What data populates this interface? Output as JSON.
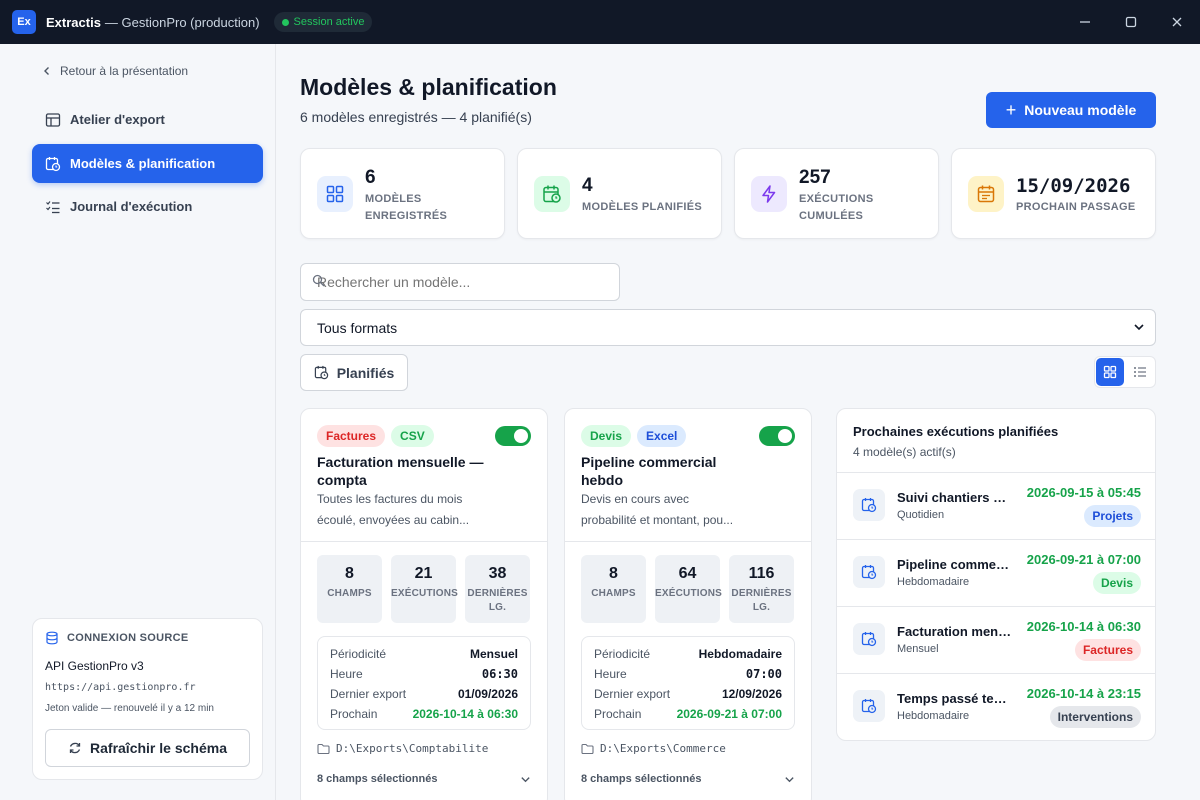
{
  "app": {
    "logo": "Ex",
    "name": "Extractis",
    "separator": "— GestionPro (production)",
    "session": "Session active",
    "window_controls": [
      "minimize-icon",
      "maximize-icon",
      "close-icon"
    ]
  },
  "sidebar": {
    "back_label": "Retour à la présentation",
    "items": [
      {
        "label": "Atelier d'export",
        "icon": "table-icon",
        "active": false
      },
      {
        "label": "Modèles & planification",
        "icon": "calendar-clock-icon",
        "active": true
      },
      {
        "label": "Journal d'exécution",
        "icon": "checklist-icon",
        "active": false
      }
    ],
    "source": {
      "title": "CONNEXION SOURCE",
      "api": "API GestionPro v3",
      "url": "https://api.gestionpro.fr",
      "token": "Jeton valide — renouvelé il y a 12 min",
      "refresh": "Rafraîchir le schéma"
    }
  },
  "header": {
    "title": "Modèles & planification",
    "subtitle": "6 modèles enregistrés — 4 planifié(s)",
    "new_button": "Nouveau modèle"
  },
  "stats": [
    {
      "value": "6",
      "label_lines": [
        "MODÈLES",
        "ENREGISTRÉS"
      ],
      "icon": "grid-icon",
      "color": "#2563eb",
      "bg": "#e8f0fe"
    },
    {
      "value": "4",
      "label_lines": [
        "MODÈLES PLANIFIÉS"
      ],
      "icon": "calendar-clock-icon",
      "color": "#16a34a",
      "bg": "#dcfce7"
    },
    {
      "value": "257",
      "label_lines": [
        "EXÉCUTIONS",
        "CUMULÉES"
      ],
      "icon": "bolt-icon",
      "color": "#7c3aed",
      "bg": "#ede9fe"
    },
    {
      "value": "15/09/2026",
      "label_lines": [
        "PROCHAIN PASSAGE"
      ],
      "icon": "calendar-icon",
      "color": "#d97706",
      "bg": "#fef3c7"
    }
  ],
  "filters": {
    "search_placeholder": "Rechercher un modèle...",
    "format_value": "Tous formats",
    "planned_label": "Planifiés",
    "view_modes": [
      "grid-view-icon",
      "list-view-icon"
    ],
    "active_view": "grid"
  },
  "models": [
    {
      "tags": [
        {
          "label": "Factures",
          "bg": "#fee2e2",
          "fg": "#dc2626"
        },
        {
          "label": "CSV",
          "bg": "#dcfce7",
          "fg": "#16a34a"
        }
      ],
      "enabled": true,
      "title": "Facturation mensuelle — compta",
      "desc_lines": [
        "Toutes les factures du mois",
        "écoulé, envoyées au cabin..."
      ],
      "stats": [
        {
          "value": "8",
          "label_lines": [
            "CHAMPS"
          ]
        },
        {
          "value": "21",
          "label_lines": [
            "EXÉCUTIONS"
          ]
        },
        {
          "value": "38",
          "label_lines": [
            "DERNIÈRES",
            "LG."
          ]
        }
      ],
      "schedule": {
        "periodicity_label": "Périodicité",
        "periodicity": "Mensuel",
        "time_label": "Heure",
        "time": "06:30",
        "last_label": "Dernier export",
        "last": "01/09/2026",
        "next_label": "Prochain",
        "next": "2026-10-14 à 06:30"
      },
      "folder": "D:\\Exports\\Comptabilite",
      "fields": "8 champs sélectionnés"
    },
    {
      "tags": [
        {
          "label": "Devis",
          "bg": "#dcfce7",
          "fg": "#16a34a"
        },
        {
          "label": "Excel",
          "bg": "#dbeafe",
          "fg": "#1d4ed8"
        }
      ],
      "enabled": true,
      "title": "Pipeline commercial hebdo",
      "desc_lines": [
        "Devis en cours avec",
        "probabilité et montant, pou..."
      ],
      "stats": [
        {
          "value": "8",
          "label_lines": [
            "CHAMPS"
          ]
        },
        {
          "value": "64",
          "label_lines": [
            "EXÉCUTIONS"
          ]
        },
        {
          "value": "116",
          "label_lines": [
            "DERNIÈRES",
            "LG."
          ]
        }
      ],
      "schedule": {
        "periodicity_label": "Périodicité",
        "periodicity": "Hebdomadaire",
        "time_label": "Heure",
        "time": "07:00",
        "last_label": "Dernier export",
        "last": "12/09/2026",
        "next_label": "Prochain",
        "next": "2026-09-21 à 07:00"
      },
      "folder": "D:\\Exports\\Commerce",
      "fields": "8 champs sélectionnés"
    }
  ],
  "upcoming": {
    "title": "Prochaines exécutions planifiées",
    "subtitle": "4 modèle(s) actif(s)",
    "rows": [
      {
        "name": "Suivi chantiers hebdomadaire",
        "freq": "Quotidien",
        "date": "2026-09-15 à 05:45",
        "badge": "Projets",
        "badge_bg": "#dbeafe",
        "badge_fg": "#1d4ed8"
      },
      {
        "name": "Pipeline commercial hebdo",
        "freq": "Hebdomadaire",
        "date": "2026-09-21 à 07:00",
        "badge": "Devis",
        "badge_bg": "#dcfce7",
        "badge_fg": "#16a34a"
      },
      {
        "name": "Facturation mensuelle — compta",
        "freq": "Mensuel",
        "date": "2026-10-14 à 06:30",
        "badge": "Factures",
        "badge_bg": "#fee2e2",
        "badge_fg": "#dc2626"
      },
      {
        "name": "Temps passé techniciens",
        "freq": "Hebdomadaire",
        "date": "2026-10-14 à 23:15",
        "badge": "Interventions",
        "badge_bg": "#e5e7eb",
        "badge_fg": "#374151"
      }
    ]
  }
}
